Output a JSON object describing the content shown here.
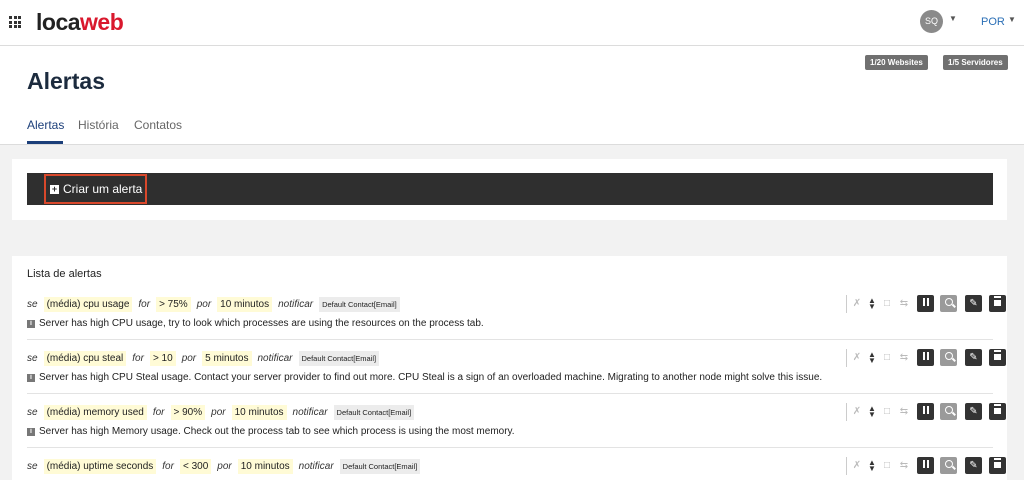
{
  "topbar": {
    "logo_part1": "loca",
    "logo_part2": "web",
    "avatar": "SQ",
    "language": "POR",
    "brand_color": "#d9182d"
  },
  "header": {
    "badge_websites": "1/20 Websites",
    "badge_servers": "1/5 Servidores",
    "title": "Alertas",
    "tabs": [
      {
        "label": "Alertas",
        "active": true
      },
      {
        "label": "História",
        "active": false
      },
      {
        "label": "Contatos",
        "active": false
      }
    ]
  },
  "create": {
    "label": "Criar um alerta"
  },
  "list": {
    "title": "Lista de alertas",
    "alerts": [
      {
        "kw_if": "se",
        "metric": "(média) cpu usage",
        "kw_for": "for",
        "threshold": "> 75%",
        "kw_by": "por",
        "duration": "10 minutos",
        "kw_notify": "notificar",
        "contact": "Default Contact[Email]",
        "description": "Server has high CPU usage, try to look which processes are using the resources on the process tab."
      },
      {
        "kw_if": "se",
        "metric": "(média) cpu steal",
        "kw_for": "for",
        "threshold": "> 10",
        "kw_by": "por",
        "duration": "5 minutos",
        "kw_notify": "notificar",
        "contact": "Default Contact[Email]",
        "description": "Server has high CPU Steal usage. Contact your server provider to find out more. CPU Steal is a sign of an overloaded machine. Migrating to another node might solve this issue."
      },
      {
        "kw_if": "se",
        "metric": "(média) memory used",
        "kw_for": "for",
        "threshold": "> 90%",
        "kw_by": "por",
        "duration": "10 minutos",
        "kw_notify": "notificar",
        "contact": "Default Contact[Email]",
        "description": "Server has high Memory usage. Check out the process tab to see which process is using the most memory."
      },
      {
        "kw_if": "se",
        "metric": "(média) uptime seconds",
        "kw_for": "for",
        "threshold": "< 300",
        "kw_by": "por",
        "duration": "10 minutos",
        "kw_notify": "notificar",
        "contact": "Default Contact[Email]",
        "description": ""
      }
    ]
  }
}
